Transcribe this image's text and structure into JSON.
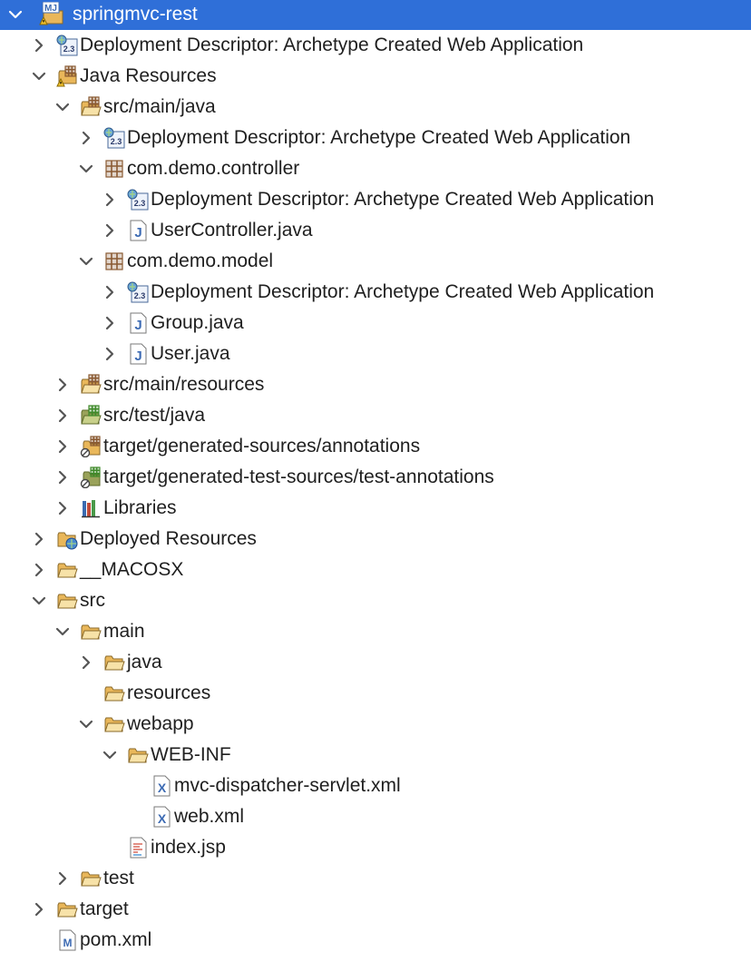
{
  "project_explorer": {
    "items": [
      {
        "label": "springmvc-rest",
        "depth": 0,
        "expander": "expanded",
        "icon": "maven-project-icon",
        "selected": true
      },
      {
        "label": "Deployment Descriptor: Archetype Created Web Application",
        "depth": 1,
        "expander": "collapsed",
        "icon": "deployment-descriptor-icon"
      },
      {
        "label": "Java Resources",
        "depth": 1,
        "expander": "expanded",
        "icon": "java-resources-icon"
      },
      {
        "label": "src/main/java",
        "depth": 2,
        "expander": "expanded",
        "icon": "source-folder-icon"
      },
      {
        "label": "Deployment Descriptor: Archetype Created Web Application",
        "depth": 3,
        "expander": "collapsed",
        "icon": "deployment-descriptor-icon"
      },
      {
        "label": "com.demo.controller",
        "depth": 3,
        "expander": "expanded",
        "icon": "package-icon"
      },
      {
        "label": "Deployment Descriptor: Archetype Created Web Application",
        "depth": 4,
        "expander": "collapsed",
        "icon": "deployment-descriptor-icon"
      },
      {
        "label": "UserController.java",
        "depth": 4,
        "expander": "collapsed",
        "icon": "java-file-icon"
      },
      {
        "label": "com.demo.model",
        "depth": 3,
        "expander": "expanded",
        "icon": "package-icon"
      },
      {
        "label": "Deployment Descriptor: Archetype Created Web Application",
        "depth": 4,
        "expander": "collapsed",
        "icon": "deployment-descriptor-icon"
      },
      {
        "label": "Group.java",
        "depth": 4,
        "expander": "collapsed",
        "icon": "java-file-icon"
      },
      {
        "label": "User.java",
        "depth": 4,
        "expander": "collapsed",
        "icon": "java-file-icon"
      },
      {
        "label": "src/main/resources",
        "depth": 2,
        "expander": "collapsed",
        "icon": "source-folder-icon"
      },
      {
        "label": "src/test/java",
        "depth": 2,
        "expander": "collapsed",
        "icon": "test-source-folder-icon"
      },
      {
        "label": "target/generated-sources/annotations",
        "depth": 2,
        "expander": "collapsed",
        "icon": "generated-source-folder-icon"
      },
      {
        "label": "target/generated-test-sources/test-annotations",
        "depth": 2,
        "expander": "collapsed",
        "icon": "generated-test-source-folder-icon"
      },
      {
        "label": "Libraries",
        "depth": 2,
        "expander": "collapsed",
        "icon": "libraries-icon"
      },
      {
        "label": "Deployed Resources",
        "depth": 1,
        "expander": "collapsed",
        "icon": "deployed-resources-icon"
      },
      {
        "label": "__MACOSX",
        "depth": 1,
        "expander": "collapsed",
        "icon": "folder-icon"
      },
      {
        "label": "src",
        "depth": 1,
        "expander": "expanded",
        "icon": "folder-icon"
      },
      {
        "label": "main",
        "depth": 2,
        "expander": "expanded",
        "icon": "folder-icon"
      },
      {
        "label": "java",
        "depth": 3,
        "expander": "collapsed",
        "icon": "folder-icon"
      },
      {
        "label": "resources",
        "depth": 3,
        "expander": "none",
        "icon": "folder-icon"
      },
      {
        "label": "webapp",
        "depth": 3,
        "expander": "expanded",
        "icon": "folder-icon"
      },
      {
        "label": "WEB-INF",
        "depth": 4,
        "expander": "expanded",
        "icon": "folder-icon"
      },
      {
        "label": "mvc-dispatcher-servlet.xml",
        "depth": 5,
        "expander": "none",
        "icon": "xml-file-icon"
      },
      {
        "label": "web.xml",
        "depth": 5,
        "expander": "none",
        "icon": "xml-file-icon"
      },
      {
        "label": "index.jsp",
        "depth": 4,
        "expander": "none",
        "icon": "jsp-file-icon"
      },
      {
        "label": "test",
        "depth": 2,
        "expander": "collapsed",
        "icon": "folder-icon"
      },
      {
        "label": "target",
        "depth": 1,
        "expander": "collapsed",
        "icon": "folder-icon"
      },
      {
        "label": "pom.xml",
        "depth": 1,
        "expander": "none",
        "icon": "maven-pom-icon"
      }
    ]
  },
  "colors": {
    "selection": "#2f6fd8",
    "text": "#1f1f1f",
    "chevron": "#555555",
    "folder": "#e9b75a",
    "package": "#8a5a33"
  }
}
